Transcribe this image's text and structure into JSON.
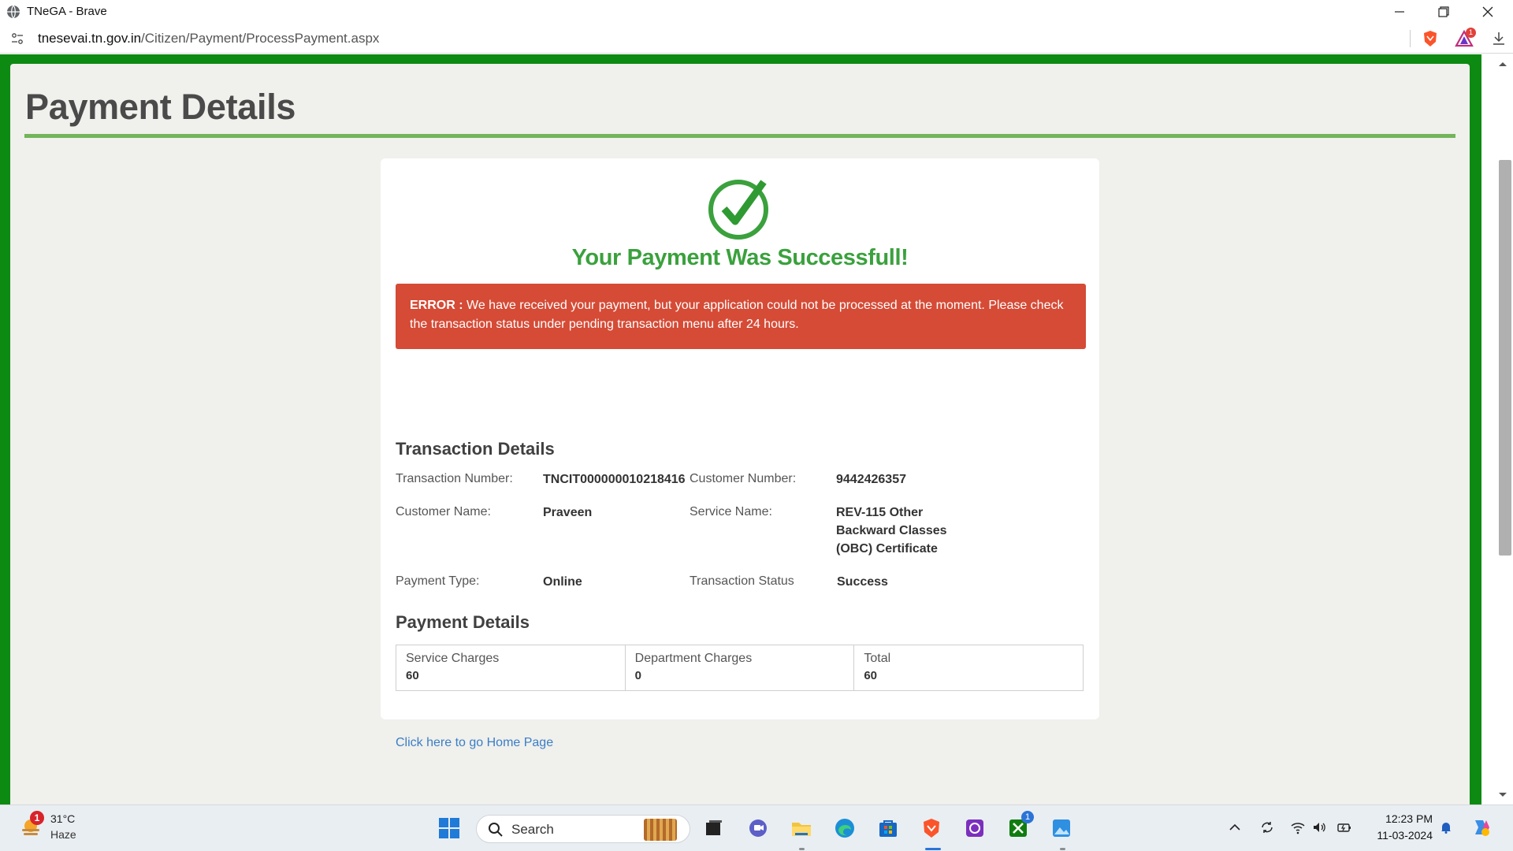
{
  "window": {
    "title": "TNeGA - Brave"
  },
  "addressbar": {
    "url_host": "tnesevai.tn.gov.in",
    "url_path": "/Citizen/Payment/ProcessPayment.aspx",
    "rewards_badge": "1"
  },
  "page": {
    "title": "Payment Details",
    "success_message": "Your Payment Was Successfull!",
    "error_label": "ERROR :",
    "error_text": " We have received your payment, but your application could not be processed at the moment. Please check the transaction status under pending transaction menu after 24 hours.",
    "transaction_section_title": "Transaction Details",
    "transaction": {
      "transaction_number_label": "Transaction Number:",
      "transaction_number": "TNCIT000000010218416",
      "customer_number_label": "Customer Number:",
      "customer_number": "9442426357",
      "customer_name_label": "Customer Name:",
      "customer_name": "Praveen",
      "service_name_label": "Service Name:",
      "service_name_line1": "REV-115 Other",
      "service_name_line2": "Backward Classes",
      "service_name_line3": "(OBC) Certificate",
      "payment_type_label": "Payment Type:",
      "payment_type": "Online",
      "transaction_status_label": "Transaction Status",
      "transaction_status": "Success"
    },
    "payment_section_title": "Payment Details",
    "charges": [
      {
        "label": "Service Charges",
        "value": "60"
      },
      {
        "label": "Department Charges",
        "value": "0"
      },
      {
        "label": "Total",
        "value": "60"
      }
    ],
    "home_link": "Click here to go Home Page"
  },
  "taskbar": {
    "weather_temp": "31°C",
    "weather_condition": "Haze",
    "weather_badge": "1",
    "search_placeholder": "Search",
    "xbox_badge": "1",
    "clock_time": "12:23 PM",
    "clock_date": "11-03-2024"
  },
  "colors": {
    "frame_green": "#0d8a12",
    "success_green": "#3aa13d",
    "error_red": "#d54b36",
    "title_rule": "#72b55a",
    "link_blue": "#3a7ec8"
  }
}
